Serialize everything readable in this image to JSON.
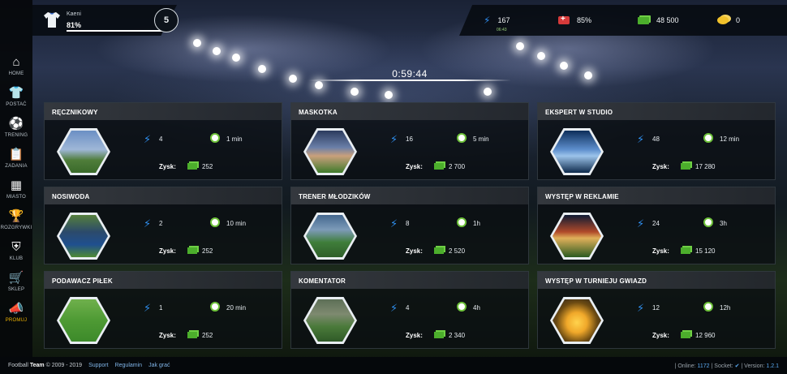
{
  "player": {
    "name": "Kaeni",
    "percent": "81%",
    "progress": 0.81,
    "level": "5"
  },
  "stats": {
    "energy": "167",
    "energy_timer": "06:43",
    "health": "85%",
    "money": "48 500",
    "coins": "0"
  },
  "timer": "0:59:44",
  "sidebar": [
    {
      "label": "HOME",
      "icon": "home-icon"
    },
    {
      "label": "POSTAĆ",
      "icon": "shirt-icon"
    },
    {
      "label": "TRENING",
      "icon": "ball-icon"
    },
    {
      "label": "ZADANIA",
      "icon": "clipboard-icon"
    },
    {
      "label": "MIASTO",
      "icon": "building-icon"
    },
    {
      "label": "ROZGRYWKI",
      "icon": "trophy-icon"
    },
    {
      "label": "KLUB",
      "icon": "club-icon"
    },
    {
      "label": "SKLEP",
      "icon": "cart-icon"
    },
    {
      "label": "PROMUJ",
      "icon": "megaphone-icon"
    }
  ],
  "profit_label": "Zysk:",
  "jobs": [
    {
      "title": "RĘCZNIKOWY",
      "energy": "4",
      "time": "1 min",
      "profit": "252"
    },
    {
      "title": "MASKOTKA",
      "energy": "16",
      "time": "5 min",
      "profit": "2 700"
    },
    {
      "title": "EKSPERT W STUDIO",
      "energy": "48",
      "time": "12 min",
      "profit": "17 280"
    },
    {
      "title": "NOSIWODA",
      "energy": "2",
      "time": "10 min",
      "profit": "252"
    },
    {
      "title": "TRENER MŁODZIKÓW",
      "energy": "8",
      "time": "1h",
      "profit": "2 520"
    },
    {
      "title": "WYSTĘP W REKLAMIE",
      "energy": "24",
      "time": "3h",
      "profit": "15 120"
    },
    {
      "title": "PODAWACZ PIŁEK",
      "energy": "1",
      "time": "20 min",
      "profit": "252"
    },
    {
      "title": "KOMENTATOR",
      "energy": "4",
      "time": "4h",
      "profit": "2 340"
    },
    {
      "title": "WYSTĘP W TURNIEJU GWIAZD",
      "energy": "12",
      "time": "12h",
      "profit": "12 960"
    }
  ],
  "footer": {
    "brand_a": "Football",
    "brand_b": "Team",
    "copyright": "© 2009 - 2019",
    "support": "Support",
    "rules": "Regulamin",
    "howto": "Jak grać",
    "online_label": "| Online:",
    "online_value": "1172",
    "socket_label": "| Socket:",
    "socket_value": "✔",
    "version_label": "| Version:",
    "version_value": "1.2.1"
  },
  "colors": {
    "energy_blue": "#2f8fef",
    "money_green": "#4cae2c",
    "coin_gold": "#f1c12b",
    "health_red": "#d63a3a"
  }
}
